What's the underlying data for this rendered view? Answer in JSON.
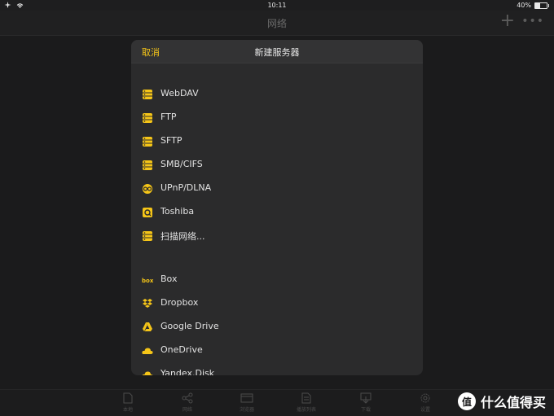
{
  "status_bar": {
    "time": "10:11",
    "battery": "40%",
    "battery_level": 0.4
  },
  "nav": {
    "title": "网络"
  },
  "modal": {
    "cancel_label": "取消",
    "title": "新建服务器",
    "section_local": [
      {
        "label": "WebDAV",
        "icon": "server-icon"
      },
      {
        "label": "FTP",
        "icon": "server-icon"
      },
      {
        "label": "SFTP",
        "icon": "server-icon"
      },
      {
        "label": "SMB/CIFS",
        "icon": "server-icon"
      },
      {
        "label": "UPnP/DLNA",
        "icon": "dlna-icon"
      },
      {
        "label": "Toshiba",
        "icon": "toshiba-icon"
      },
      {
        "label": "扫描网络...",
        "icon": "server-icon"
      }
    ],
    "section_cloud": [
      {
        "label": "Box",
        "icon": "box-logo-icon"
      },
      {
        "label": "Dropbox",
        "icon": "dropbox-icon"
      },
      {
        "label": "Google Drive",
        "icon": "google-drive-icon"
      },
      {
        "label": "OneDrive",
        "icon": "onedrive-icon"
      },
      {
        "label": "Yandex.Disk",
        "icon": "cloud-icon"
      }
    ]
  },
  "tab_bar": {
    "tabs": [
      {
        "label": "本地",
        "icon": "file-icon"
      },
      {
        "label": "网络",
        "icon": "share-icon"
      },
      {
        "label": "浏览器",
        "icon": "browser-icon"
      },
      {
        "label": "播放列表",
        "icon": "playlist-icon"
      },
      {
        "label": "下载",
        "icon": "download-icon"
      },
      {
        "label": "设置",
        "icon": "gear-icon"
      }
    ]
  },
  "watermark": {
    "badge": "值",
    "text": "什么值得买"
  },
  "colors": {
    "accent": "#f5c518",
    "background": "#1e1e1f",
    "modal_bg": "#2b2b2c"
  }
}
